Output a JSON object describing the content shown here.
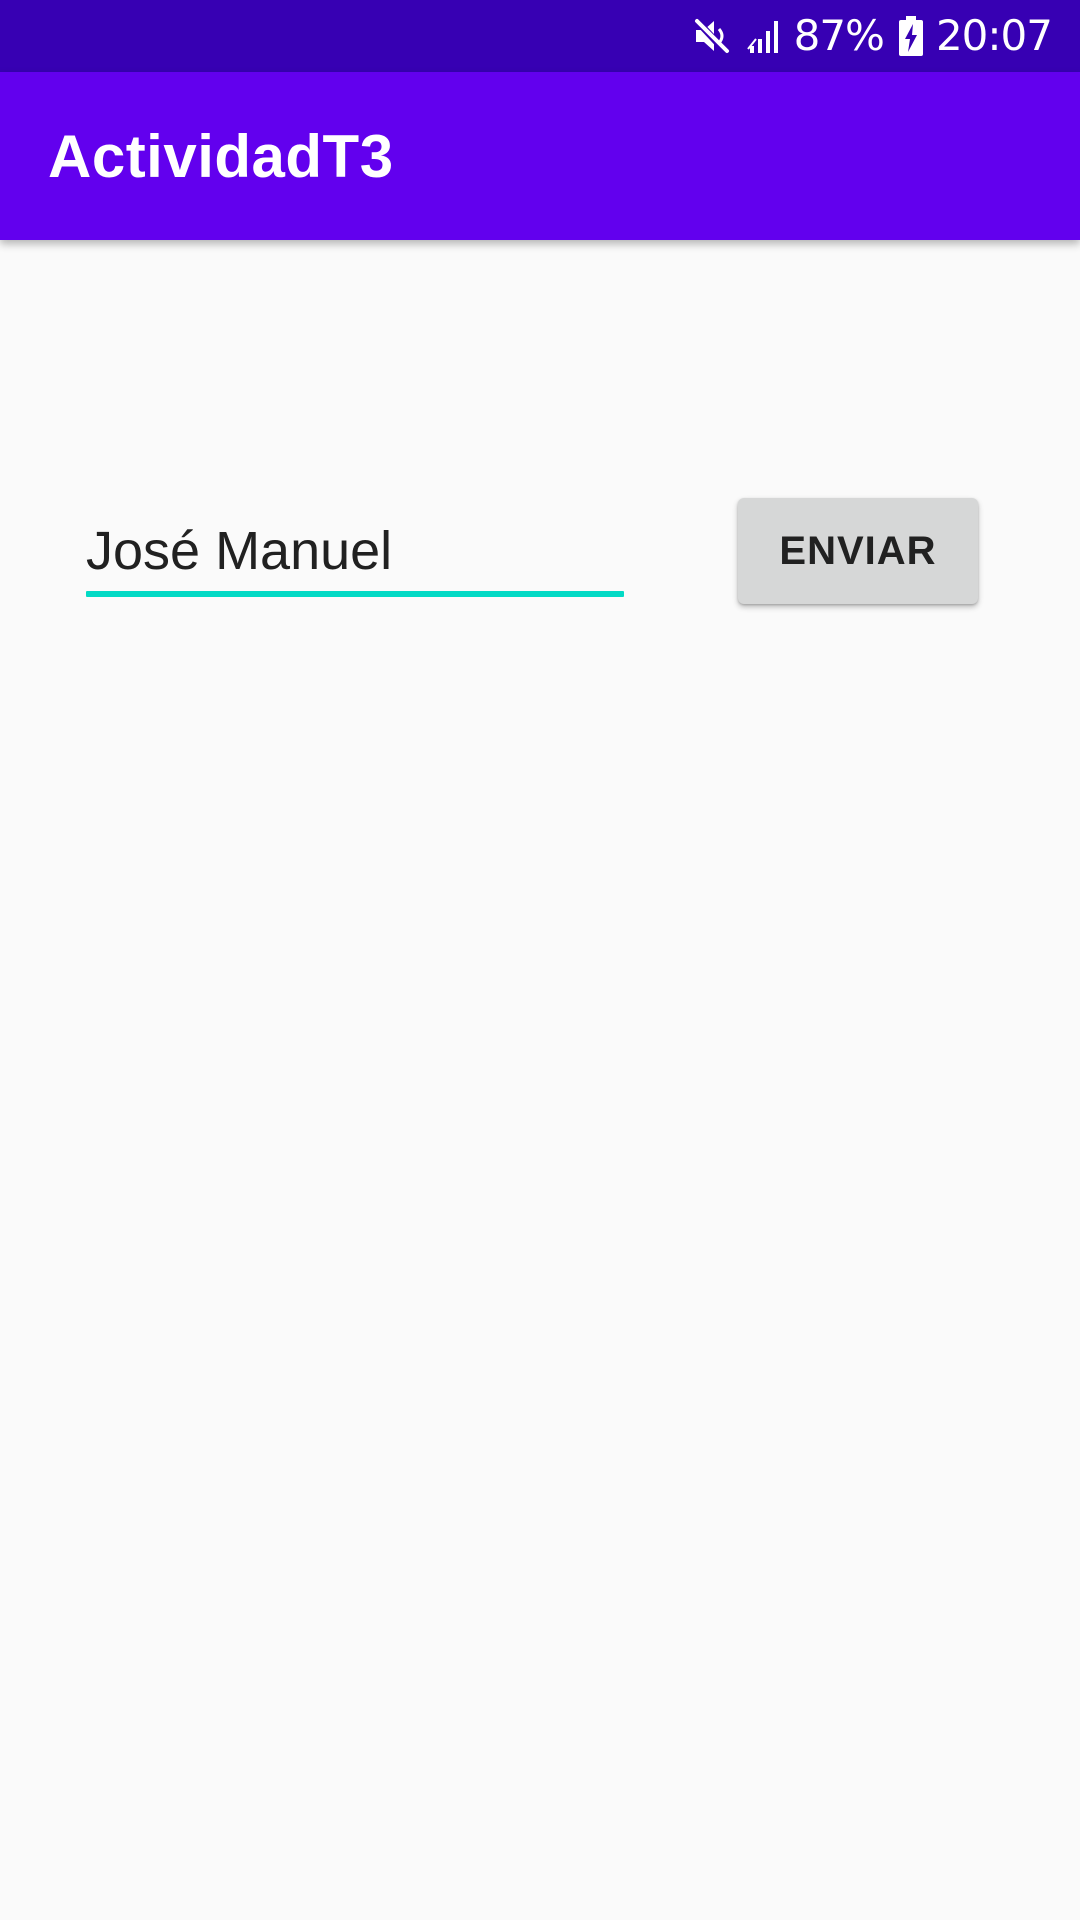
{
  "status_bar": {
    "icons": [
      "mute-icon",
      "signal-icon",
      "battery-charging-icon"
    ],
    "battery_percent": "87%",
    "time": "20:07"
  },
  "app_bar": {
    "title": "ActividadT3"
  },
  "form": {
    "name_value": "José Manuel",
    "send_label": "ENVIAR"
  },
  "colors": {
    "status_bar": "#3700b3",
    "primary": "#6200ee",
    "accent": "#03dac5",
    "background": "#fafafa",
    "button": "#d6d7d7"
  }
}
